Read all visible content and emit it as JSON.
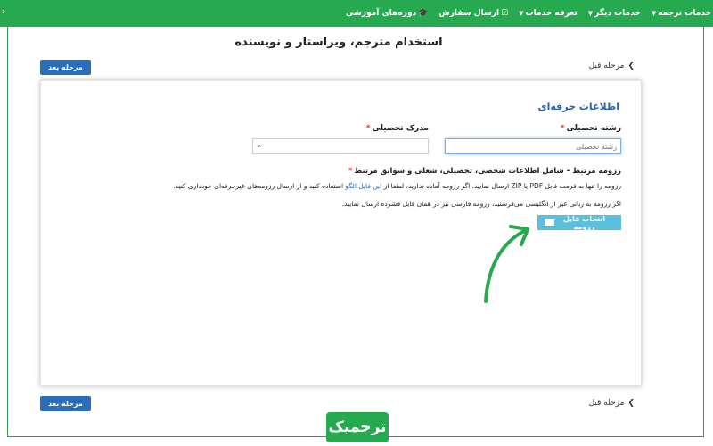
{
  "nav": {
    "items": [
      {
        "label": "خدمات ترجمه",
        "caret": "▼"
      },
      {
        "label": "خدمات دیگر",
        "caret": "▼"
      },
      {
        "label": "تعرفه خدمات",
        "caret": "▼"
      },
      {
        "label": "ارسال سفارش",
        "icon": "☑"
      },
      {
        "label": "دوره‌های آموزشی",
        "icon": "🎓"
      }
    ],
    "left_glyph": "‹"
  },
  "page": {
    "title": "استخدام مترجم، ویراستار و نویسنده",
    "next_label": "مرحله بعد",
    "prev_label": "مرحله قبل"
  },
  "form": {
    "section_title": "اطلاعات حرفه‌ای",
    "field_major_label": "رشته تحصیلی",
    "field_major_placeholder": "رشته تحصیلی",
    "field_degree_label": "مدرک تحصیلی",
    "required_mark": "*",
    "resume_label": "رزومه مرتبط - شامل اطلاعات شخصی، تحصیلی، شغلی و سوابق مرتبط",
    "note_line1_a": "رزومه را تنها به فرمت فایل PDF یا ZIP ارسال نمایید. اگر رزومه آماده ندارید، لطفا از ",
    "note_line1_link": "این فایل الگو",
    "note_line1_b": " استفاده کنید و از ارسال رزومه‌های غیرحرفه‌ای خودداری کنید.",
    "note_line2": "اگر رزومه به زبانی غیر از انگلیسی می‌فرستید، رزومه فارسی نیز در همان فایل فشرده ارسال نمایید.",
    "upload_label": "انتخاب فایل رزومه"
  },
  "brand": {
    "logo_text": "ترجمیک",
    "accent": "#27a94f",
    "button_blue": "#2a6ebb",
    "upload_cyan": "#5bc0de"
  }
}
